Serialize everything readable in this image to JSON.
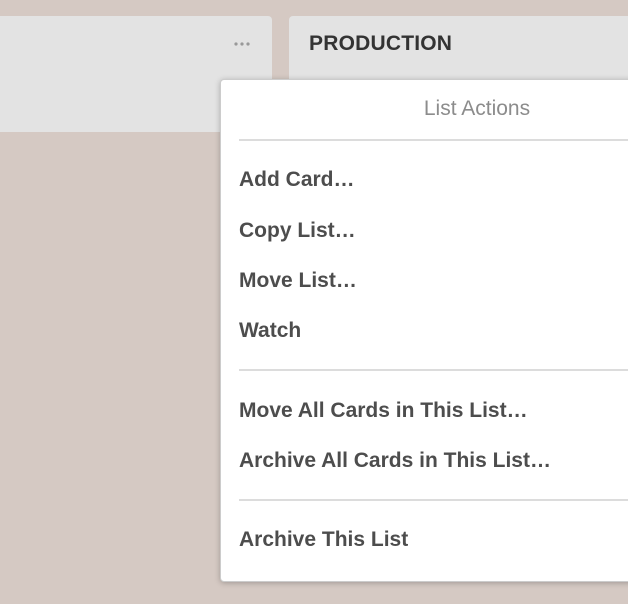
{
  "lists": {
    "left": {
      "menu_icon": "ellipsis-icon"
    },
    "right": {
      "title": "PRODUCTION"
    }
  },
  "popover": {
    "title": "List Actions",
    "items": [
      {
        "label": "Add Card…"
      },
      {
        "label": "Copy List…"
      },
      {
        "label": "Move List…"
      },
      {
        "label": "Watch"
      },
      {
        "label": "Move All Cards in This List…"
      },
      {
        "label": "Archive All Cards in This List…"
      },
      {
        "label": "Archive This List"
      }
    ]
  },
  "colors": {
    "board_background": "#d5c9c3",
    "list_background": "#e3e3e3",
    "popover_background": "#ffffff",
    "menu_text": "#4d4d4d",
    "title_text": "#8c8c8c"
  }
}
